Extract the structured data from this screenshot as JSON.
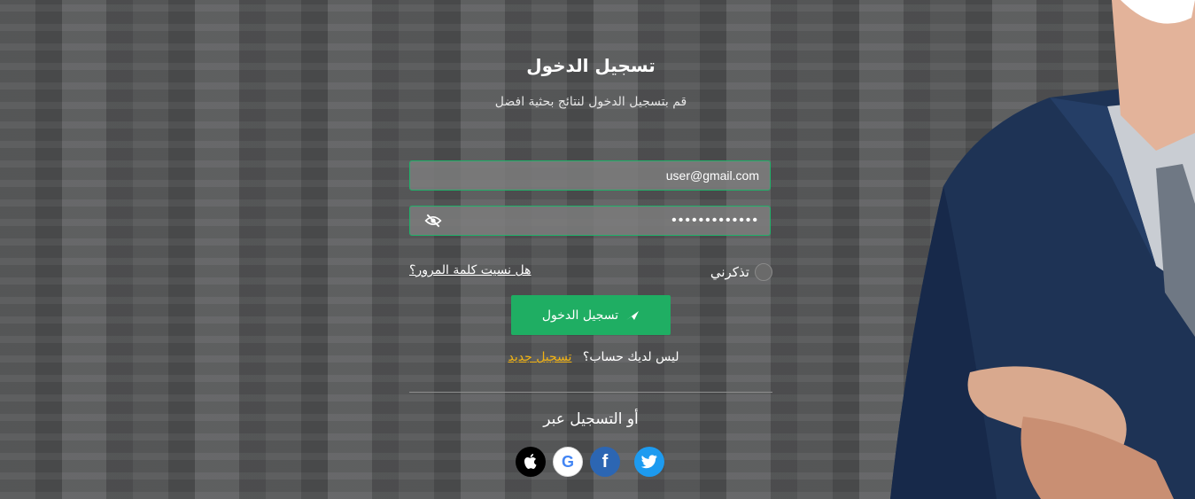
{
  "login": {
    "title": "تسجيل الدخول",
    "subtitle": "قم بتسجيل الدخول لنتائج بحثية افضل",
    "email_value": "user@gmail.com",
    "password_value": "•••••••••••••",
    "remember_label": "تذكرني",
    "forgot_label": "هل نسيت كلمة المرور؟",
    "submit_label": "تسجيل الدخول",
    "no_account_text": "ليس لديك حساب؟",
    "signup_link": "تسجيل جديد",
    "or_text": "أو التسجيل عبر"
  },
  "social": {
    "google_letter": "G",
    "facebook_letter": "f"
  },
  "colors": {
    "accent": "#1fae63",
    "link": "#f1b213",
    "field_border": "#20b26a"
  },
  "icons": [
    "eye-slash-icon",
    "paper-plane-icon",
    "apple-icon",
    "google-icon",
    "facebook-icon",
    "twitter-icon"
  ]
}
